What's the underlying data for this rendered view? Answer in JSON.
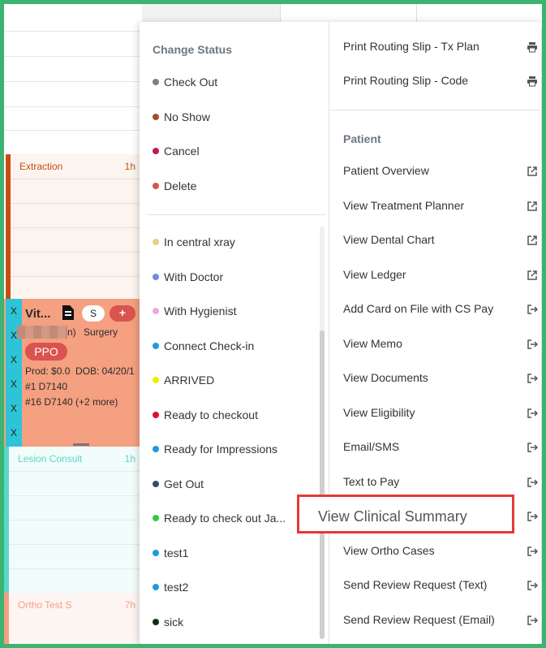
{
  "calendar": {
    "appointments": [
      {
        "title": "Extraction",
        "duration": "1h",
        "color": "#c94d12"
      },
      {
        "title": "Lesion Consult",
        "duration": "1h",
        "color": "#58d6c9"
      },
      {
        "title": "Ortho Test S",
        "duration": "7h",
        "color": "#f4a081"
      }
    ],
    "card": {
      "x_labels": [
        "X",
        "X",
        "X",
        "X",
        "X",
        "X"
      ],
      "title": "Vit...",
      "s_label": "S",
      "add_label": "+",
      "partial_name": "n)",
      "procedure_type": "Surgery",
      "insurance": "PPO",
      "prod_line": "Prod: $0.0",
      "dob_line": "DOB: 04/20/1",
      "proc1": "#1 D7140",
      "proc2": "#16 D7140 (+2 more)"
    }
  },
  "menu": {
    "change_status": {
      "title": "Change Status",
      "items": [
        {
          "label": "Check Out",
          "color": "#808080"
        },
        {
          "label": "No Show",
          "color": "#a0522d"
        },
        {
          "label": "Cancel",
          "color": "#c2185b"
        },
        {
          "label": "Delete",
          "color": "#d9534f"
        }
      ]
    },
    "custom_status": [
      {
        "label": "In central xray",
        "color": "#e8d080"
      },
      {
        "label": "With Doctor",
        "color": "#6f8fd8"
      },
      {
        "label": "With Hygienist",
        "color": "#f0a8d8"
      },
      {
        "label": "Connect Check-in",
        "color": "#1e9ae0"
      },
      {
        "label": "ARRIVED",
        "color": "#f2ec00"
      },
      {
        "label": "Ready to checkout",
        "color": "#e0102a"
      },
      {
        "label": "Ready for Impressions",
        "color": "#1e9ae0"
      },
      {
        "label": "Get Out",
        "color": "#2c4f6e"
      },
      {
        "label": "Ready to check out Ja...",
        "color": "#2ecc40"
      },
      {
        "label": "test1",
        "color": "#1e9ae0"
      },
      {
        "label": "test2",
        "color": "#1e9ae0"
      },
      {
        "label": "sick",
        "color": "#0d2f14"
      }
    ],
    "print_items": [
      {
        "label": "Print Routing Slip - Tx Plan",
        "icon": "printer-icon"
      },
      {
        "label": "Print Routing Slip - Code",
        "icon": "printer-icon"
      }
    ],
    "patient": {
      "title": "Patient",
      "items": [
        {
          "label": "Patient Overview",
          "icon": "external-link-icon"
        },
        {
          "label": "View Treatment Planner",
          "icon": "external-link-icon"
        },
        {
          "label": "View Dental Chart",
          "icon": "external-link-icon"
        },
        {
          "label": "View Ledger",
          "icon": "external-link-icon"
        },
        {
          "label": "Add Card on File with CS Pay",
          "icon": "open-panel-icon"
        },
        {
          "label": "View Memo",
          "icon": "open-panel-icon"
        },
        {
          "label": "View Documents",
          "icon": "open-panel-icon"
        },
        {
          "label": "View Eligibility",
          "icon": "open-panel-icon"
        },
        {
          "label": "Email/SMS",
          "icon": "open-panel-icon"
        },
        {
          "label": "Text to Pay",
          "icon": "open-panel-icon"
        },
        {
          "label": "View Clinical Summary",
          "icon": "open-panel-icon"
        },
        {
          "label": "View Ortho Cases",
          "icon": "open-panel-icon"
        },
        {
          "label": "Send Review Request (Text)",
          "icon": "open-panel-icon"
        },
        {
          "label": "Send Review Request (Email)",
          "icon": "open-panel-icon"
        }
      ]
    },
    "highlighted_label": "View Clinical Summary",
    "highlight_color": "#e53935"
  }
}
